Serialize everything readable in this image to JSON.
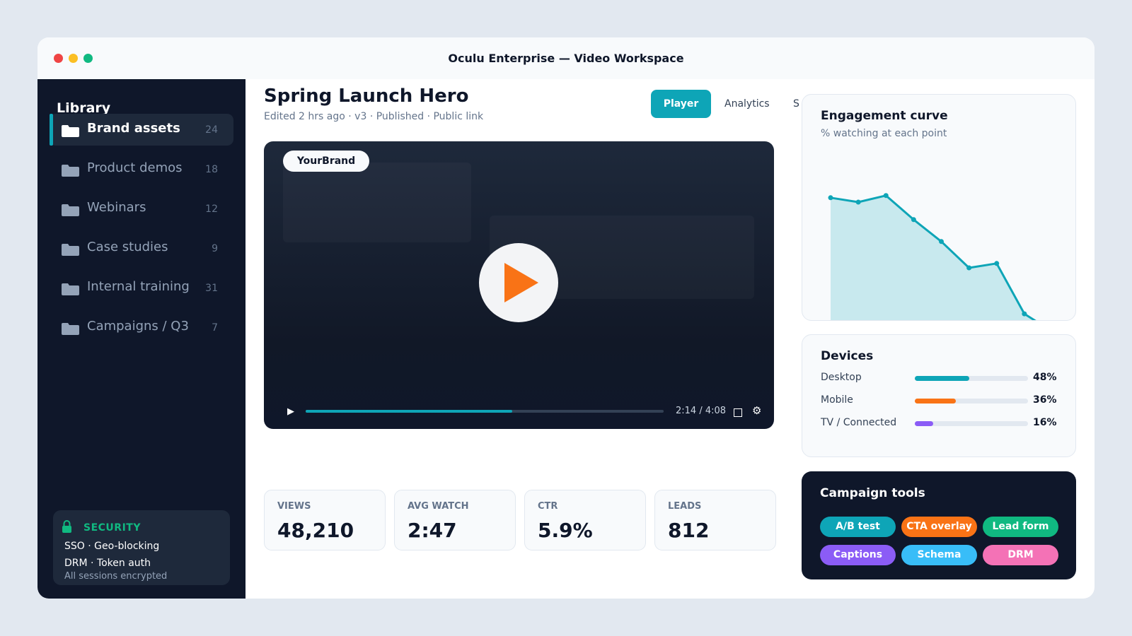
{
  "window": {
    "title": "Oculu Enterprise — Video Workspace"
  },
  "sidebar": {
    "title": "Library",
    "items": [
      {
        "label": "Brand assets",
        "count": "24",
        "active": true
      },
      {
        "label": "Product demos",
        "count": "18"
      },
      {
        "label": "Webinars",
        "count": "12"
      },
      {
        "label": "Case studies",
        "count": "9"
      },
      {
        "label": "Internal training",
        "count": "31"
      },
      {
        "label": "Campaigns / Q3",
        "count": "7"
      }
    ],
    "security": {
      "title": "SECURITY",
      "line1": "SSO · Geo-blocking",
      "line2": "DRM · Token auth",
      "note": "All sessions encrypted"
    }
  },
  "header": {
    "title": "Spring Launch Hero",
    "meta": "Edited 2 hrs ago · v3 · Published · Public link",
    "tabs": [
      {
        "label": "Player",
        "active": true
      },
      {
        "label": "Analytics"
      },
      {
        "label": "S"
      }
    ]
  },
  "player": {
    "brand_badge": "YourBrand",
    "time": "2:14 / 4:08",
    "progress": 0.578
  },
  "stats": [
    {
      "label": "VIEWS",
      "value": "48,210"
    },
    {
      "label": "AVG WATCH",
      "value": "2:47"
    },
    {
      "label": "CTR",
      "value": "5.9%"
    },
    {
      "label": "LEADS",
      "value": "812"
    }
  ],
  "engagement": {
    "title": "Engagement curve",
    "subtitle": "% watching at each point"
  },
  "chart_data": {
    "type": "area",
    "title": "Engagement curve",
    "subtitle": "% watching at each point",
    "x": [
      0,
      1,
      2,
      3,
      4,
      5,
      6,
      7,
      8
    ],
    "values": [
      82,
      80,
      83,
      72,
      62,
      50,
      52,
      29,
      21
    ],
    "ylim": [
      0,
      100
    ],
    "grid": false,
    "color": "#0ea5b7"
  },
  "devices": {
    "title": "Devices",
    "rows": [
      {
        "label": "Desktop",
        "pct": "48%",
        "value": 48,
        "color": "#0ea5b7"
      },
      {
        "label": "Mobile",
        "pct": "36%",
        "value": 36,
        "color": "#f97316"
      },
      {
        "label": "TV / Connected",
        "pct": "16%",
        "value": 16,
        "color": "#8b5cf6"
      }
    ]
  },
  "tools": {
    "title": "Campaign tools",
    "chips": [
      {
        "label": "A/B test",
        "color": "#0ea5b7"
      },
      {
        "label": "CTA overlay",
        "color": "#f97316"
      },
      {
        "label": "Lead form",
        "color": "#10b981"
      },
      {
        "label": "Captions",
        "color": "#8b5cf6"
      },
      {
        "label": "Schema",
        "color": "#38bdf8"
      },
      {
        "label": "DRM",
        "color": "#f472b6"
      }
    ]
  },
  "colors": {
    "accent": "#0ea5b7",
    "sidebar": "#0f172a",
    "play": "#f97316",
    "security": "#10b981"
  }
}
